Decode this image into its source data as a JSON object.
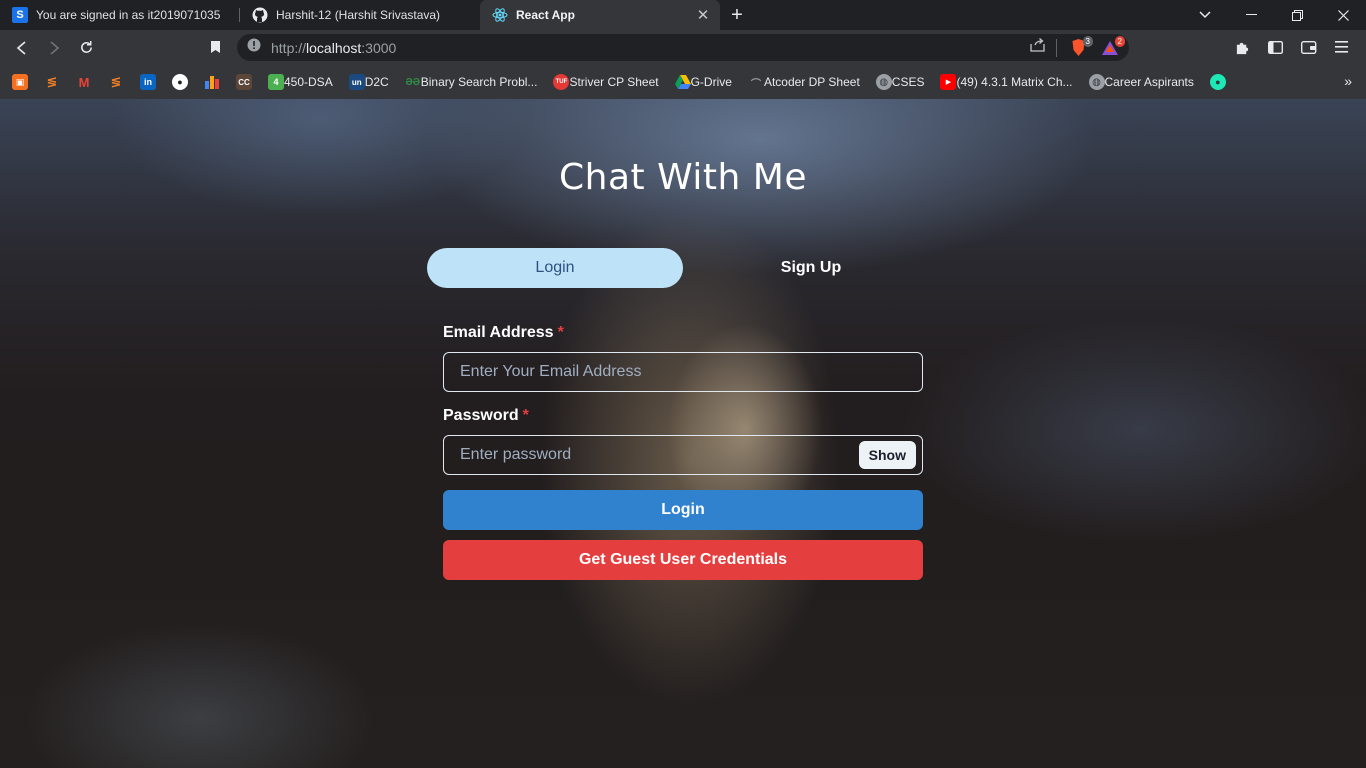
{
  "browser": {
    "tabs": [
      {
        "title": "You are signed in as it2019071035",
        "favicon": "s-icon",
        "active": false
      },
      {
        "title": "Harshit-12 (Harshit Srivastava)",
        "favicon": "github-icon",
        "active": false
      },
      {
        "title": "React App",
        "favicon": "react-icon",
        "active": true
      }
    ],
    "new_tab_label": "+",
    "url_scheme": "http://",
    "url_host": "localhost",
    "url_port": ":3000",
    "extension_badges": {
      "brave_shields": "3",
      "rewards": "2"
    },
    "bookmarks": [
      {
        "label": "",
        "icon": "hand-icon",
        "color": "#f37021"
      },
      {
        "label": "",
        "icon": "stack-icon",
        "color": "#f48024"
      },
      {
        "label": "",
        "icon": "gmail-icon",
        "color": "#ea4335"
      },
      {
        "label": "",
        "icon": "stack-icon-2",
        "color": "#f48024"
      },
      {
        "label": "",
        "icon": "linkedin-icon",
        "color": "#0a66c2"
      },
      {
        "label": "",
        "icon": "github-icon",
        "color": "#ffffff"
      },
      {
        "label": "",
        "icon": "chart-icon",
        "color": "#ffa116"
      },
      {
        "label": "",
        "icon": "cc-icon",
        "color": "#5b4638"
      },
      {
        "label": "450-DSA",
        "icon": "four-icon",
        "color": "#4caf50"
      },
      {
        "label": "D2C",
        "icon": "unstop-icon",
        "color": "#1c4980"
      },
      {
        "label": "Binary Search Probl...",
        "icon": "gfg-icon",
        "color": "#2f8d46"
      },
      {
        "label": "Striver CP Sheet",
        "icon": "tuf-icon",
        "color": "#e53935"
      },
      {
        "label": "G-Drive",
        "icon": "drive-icon",
        "color": "#fbbc04"
      },
      {
        "label": "Atcoder DP Sheet",
        "icon": "atcoder-icon",
        "color": "#9aa0a6"
      },
      {
        "label": "CSES",
        "icon": "globe-icon",
        "color": "#9aa0a6"
      },
      {
        "label": "(49) 4.3.1 Matrix Ch...",
        "icon": "youtube-icon",
        "color": "#ff0000"
      },
      {
        "label": "Career Aspirants",
        "icon": "globe-icon",
        "color": "#9aa0a6"
      },
      {
        "label": "",
        "icon": "chat-icon",
        "color": "#1de9b6"
      }
    ],
    "bookmarks_overflow": "»"
  },
  "app": {
    "title": "Chat With Me",
    "tabs": [
      "Login",
      "Sign Up"
    ],
    "email_label": "Email Address",
    "email_placeholder": "Enter Your Email Address",
    "password_label": "Password",
    "password_placeholder": "Enter password",
    "required_mark": "*",
    "show_label": "Show",
    "login_button": "Login",
    "guest_button": "Get Guest User Credentials",
    "colors": {
      "tab_selected_bg": "#bee3f8",
      "login_button": "#3182ce",
      "guest_button": "#e53e3e"
    }
  }
}
